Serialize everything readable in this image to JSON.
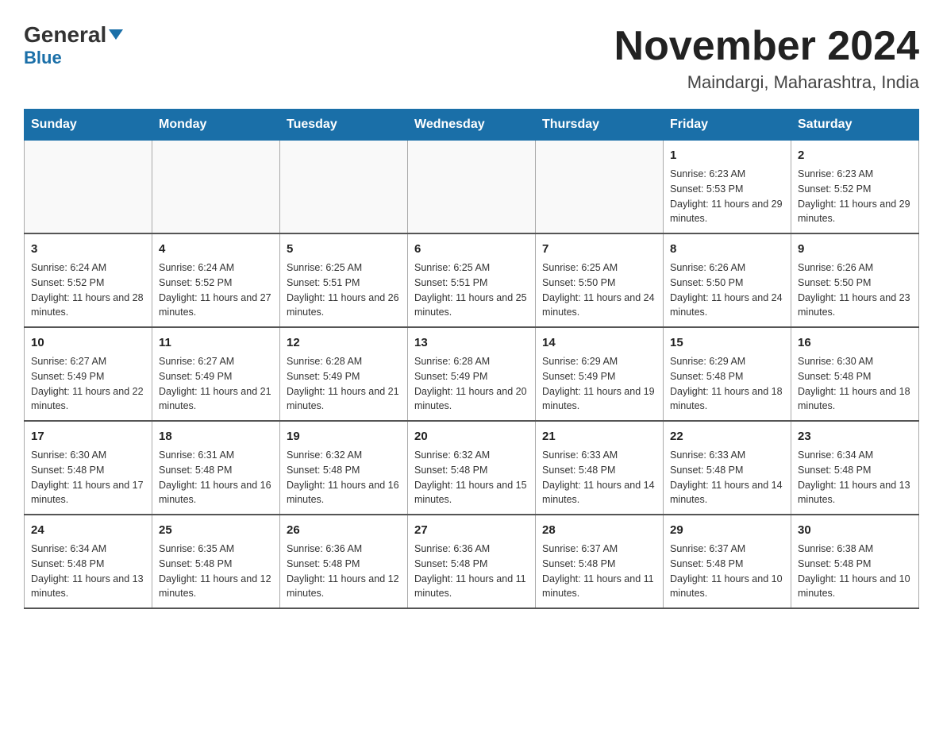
{
  "header": {
    "logo_general": "General",
    "logo_blue": "Blue",
    "month_title": "November 2024",
    "location": "Maindargi, Maharashtra, India"
  },
  "days_of_week": [
    "Sunday",
    "Monday",
    "Tuesday",
    "Wednesday",
    "Thursday",
    "Friday",
    "Saturday"
  ],
  "weeks": [
    [
      {
        "day": "",
        "info": ""
      },
      {
        "day": "",
        "info": ""
      },
      {
        "day": "",
        "info": ""
      },
      {
        "day": "",
        "info": ""
      },
      {
        "day": "",
        "info": ""
      },
      {
        "day": "1",
        "info": "Sunrise: 6:23 AM\nSunset: 5:53 PM\nDaylight: 11 hours and 29 minutes."
      },
      {
        "day": "2",
        "info": "Sunrise: 6:23 AM\nSunset: 5:52 PM\nDaylight: 11 hours and 29 minutes."
      }
    ],
    [
      {
        "day": "3",
        "info": "Sunrise: 6:24 AM\nSunset: 5:52 PM\nDaylight: 11 hours and 28 minutes."
      },
      {
        "day": "4",
        "info": "Sunrise: 6:24 AM\nSunset: 5:52 PM\nDaylight: 11 hours and 27 minutes."
      },
      {
        "day": "5",
        "info": "Sunrise: 6:25 AM\nSunset: 5:51 PM\nDaylight: 11 hours and 26 minutes."
      },
      {
        "day": "6",
        "info": "Sunrise: 6:25 AM\nSunset: 5:51 PM\nDaylight: 11 hours and 25 minutes."
      },
      {
        "day": "7",
        "info": "Sunrise: 6:25 AM\nSunset: 5:50 PM\nDaylight: 11 hours and 24 minutes."
      },
      {
        "day": "8",
        "info": "Sunrise: 6:26 AM\nSunset: 5:50 PM\nDaylight: 11 hours and 24 minutes."
      },
      {
        "day": "9",
        "info": "Sunrise: 6:26 AM\nSunset: 5:50 PM\nDaylight: 11 hours and 23 minutes."
      }
    ],
    [
      {
        "day": "10",
        "info": "Sunrise: 6:27 AM\nSunset: 5:49 PM\nDaylight: 11 hours and 22 minutes."
      },
      {
        "day": "11",
        "info": "Sunrise: 6:27 AM\nSunset: 5:49 PM\nDaylight: 11 hours and 21 minutes."
      },
      {
        "day": "12",
        "info": "Sunrise: 6:28 AM\nSunset: 5:49 PM\nDaylight: 11 hours and 21 minutes."
      },
      {
        "day": "13",
        "info": "Sunrise: 6:28 AM\nSunset: 5:49 PM\nDaylight: 11 hours and 20 minutes."
      },
      {
        "day": "14",
        "info": "Sunrise: 6:29 AM\nSunset: 5:49 PM\nDaylight: 11 hours and 19 minutes."
      },
      {
        "day": "15",
        "info": "Sunrise: 6:29 AM\nSunset: 5:48 PM\nDaylight: 11 hours and 18 minutes."
      },
      {
        "day": "16",
        "info": "Sunrise: 6:30 AM\nSunset: 5:48 PM\nDaylight: 11 hours and 18 minutes."
      }
    ],
    [
      {
        "day": "17",
        "info": "Sunrise: 6:30 AM\nSunset: 5:48 PM\nDaylight: 11 hours and 17 minutes."
      },
      {
        "day": "18",
        "info": "Sunrise: 6:31 AM\nSunset: 5:48 PM\nDaylight: 11 hours and 16 minutes."
      },
      {
        "day": "19",
        "info": "Sunrise: 6:32 AM\nSunset: 5:48 PM\nDaylight: 11 hours and 16 minutes."
      },
      {
        "day": "20",
        "info": "Sunrise: 6:32 AM\nSunset: 5:48 PM\nDaylight: 11 hours and 15 minutes."
      },
      {
        "day": "21",
        "info": "Sunrise: 6:33 AM\nSunset: 5:48 PM\nDaylight: 11 hours and 14 minutes."
      },
      {
        "day": "22",
        "info": "Sunrise: 6:33 AM\nSunset: 5:48 PM\nDaylight: 11 hours and 14 minutes."
      },
      {
        "day": "23",
        "info": "Sunrise: 6:34 AM\nSunset: 5:48 PM\nDaylight: 11 hours and 13 minutes."
      }
    ],
    [
      {
        "day": "24",
        "info": "Sunrise: 6:34 AM\nSunset: 5:48 PM\nDaylight: 11 hours and 13 minutes."
      },
      {
        "day": "25",
        "info": "Sunrise: 6:35 AM\nSunset: 5:48 PM\nDaylight: 11 hours and 12 minutes."
      },
      {
        "day": "26",
        "info": "Sunrise: 6:36 AM\nSunset: 5:48 PM\nDaylight: 11 hours and 12 minutes."
      },
      {
        "day": "27",
        "info": "Sunrise: 6:36 AM\nSunset: 5:48 PM\nDaylight: 11 hours and 11 minutes."
      },
      {
        "day": "28",
        "info": "Sunrise: 6:37 AM\nSunset: 5:48 PM\nDaylight: 11 hours and 11 minutes."
      },
      {
        "day": "29",
        "info": "Sunrise: 6:37 AM\nSunset: 5:48 PM\nDaylight: 11 hours and 10 minutes."
      },
      {
        "day": "30",
        "info": "Sunrise: 6:38 AM\nSunset: 5:48 PM\nDaylight: 11 hours and 10 minutes."
      }
    ]
  ]
}
